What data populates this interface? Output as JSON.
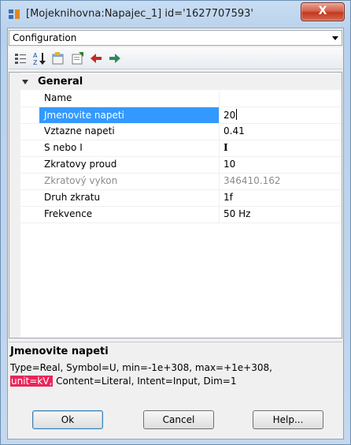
{
  "window": {
    "title": "[Mojeknihovna:Napajec_1] id='1627707593'",
    "close_label": "X"
  },
  "combo": {
    "value": "Configuration"
  },
  "toolbar": {
    "icons": [
      "categorized-icon",
      "alphabetical-sort-icon",
      "property-pages-icon",
      "export-icon",
      "red-arrow-icon",
      "green-arrow-icon"
    ]
  },
  "grid": {
    "category": "General",
    "properties": [
      {
        "name": "Name",
        "value": ""
      },
      {
        "name": "Jmenovite napeti",
        "value": "20"
      },
      {
        "name": "Vztazne napeti",
        "value": "0.41"
      },
      {
        "name": "S nebo I",
        "value": "I"
      },
      {
        "name": "Zkratovy proud",
        "value": "10"
      },
      {
        "name": "Zkratový vykon",
        "value": "346410.162"
      },
      {
        "name": "Druh zkratu",
        "value": "1f"
      },
      {
        "name": "Frekvence",
        "value": "50 Hz"
      }
    ]
  },
  "description": {
    "title": "Jmenovite napeti",
    "line1": "Type=Real, Symbol=U, min=-1e+308, max=+1e+308,",
    "unit": "unit=kV,",
    "line2_rest": " Content=Literal, Intent=Input, Dim=1"
  },
  "buttons": {
    "ok": "Ok",
    "cancel": "Cancel",
    "help": "Help..."
  },
  "colors": {
    "selection": "#3399ff",
    "highlight": "#e8265a",
    "close": "#c2381f"
  }
}
